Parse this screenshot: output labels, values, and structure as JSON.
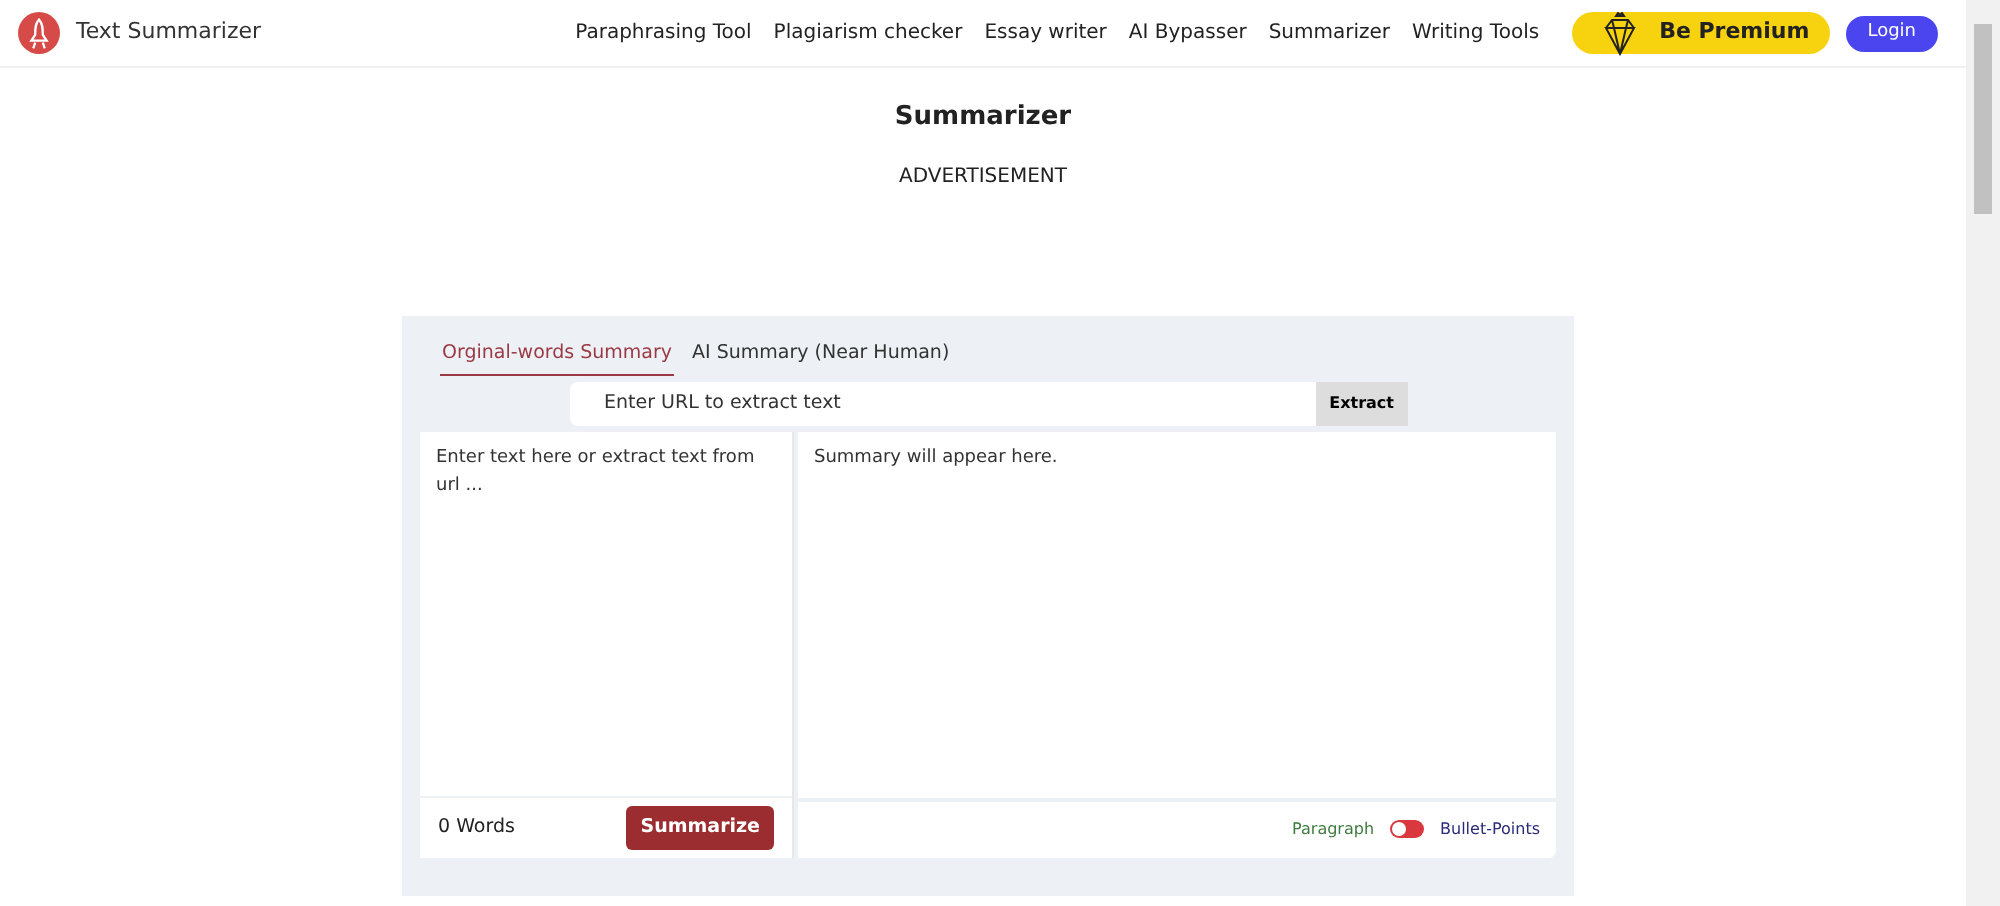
{
  "brand": {
    "name": "Text Summarizer"
  },
  "nav": {
    "links": [
      "Paraphrasing Tool",
      "Plagiarism checker",
      "Essay writer",
      "AI Bypasser",
      "Summarizer",
      "Writing Tools"
    ],
    "premium": "Be Premium",
    "login": "Login"
  },
  "page": {
    "title": "Summarizer",
    "ad": "ADVERTISEMENT"
  },
  "tabs": [
    {
      "label": "Orginal-words Summary",
      "selected": true
    },
    {
      "label": "AI Summary (Near Human)",
      "selected": false
    }
  ],
  "url_bar": {
    "placeholder": "Enter URL to extract text",
    "button": "Extract"
  },
  "input": {
    "placeholder": "Enter text here or extract text from url ...",
    "word_count": "0 Words",
    "button": "Summarize"
  },
  "output": {
    "placeholder": "Summary will appear here.",
    "left_label": "Paragraph",
    "right_label": "Bullet-Points",
    "toggle_on": false
  }
}
